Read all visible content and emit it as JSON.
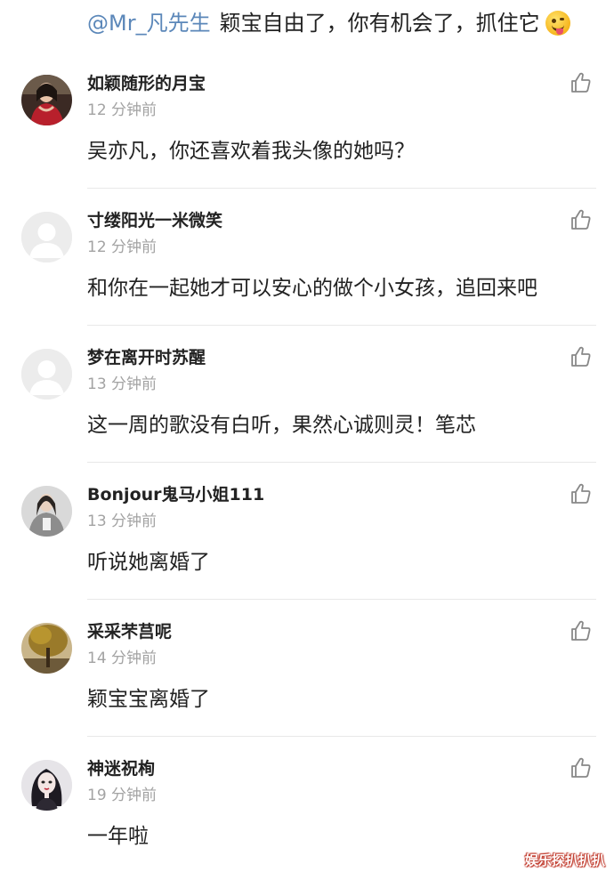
{
  "top_reply": {
    "mention": "@Mr_凡先生",
    "text": "颖宝自由了，你有机会了，抓住它",
    "emoji": "tongue-wink-emoji"
  },
  "comments": [
    {
      "username": "如颖随形的月宝",
      "time": "12 分钟前",
      "content": "吴亦凡，你还喜欢着我头像的她吗？",
      "avatar": "portrait-red-dress"
    },
    {
      "username": "寸缕阳光一米微笑",
      "time": "12 分钟前",
      "content": "和你在一起她才可以安心的做个小女孩，追回来吧",
      "avatar": "default-grey"
    },
    {
      "username": "梦在离开时苏醒",
      "time": "13 分钟前",
      "content": "这一周的歌没有白听，果然心诚则灵！笔芯",
      "avatar": "default-grey"
    },
    {
      "username": "Bonjour鬼马小姐111",
      "time": "13 分钟前",
      "content": "听说她离婚了",
      "avatar": "portrait-grey-outfit"
    },
    {
      "username": "采采芣莒呢",
      "time": "14 分钟前",
      "content": "颖宝宝离婚了",
      "avatar": "autumn-tree"
    },
    {
      "username": "神迷祝栒",
      "time": "19 分钟前",
      "content": "一年啦",
      "avatar": "illustrated-woman"
    }
  ],
  "like_icon": "thumbs-up-outline-icon",
  "watermark": "娱乐探扒扒扒",
  "colors": {
    "mention": "#5b87b9",
    "time": "#a3a3a3",
    "divider": "#e8e8e8",
    "text": "#222222"
  }
}
